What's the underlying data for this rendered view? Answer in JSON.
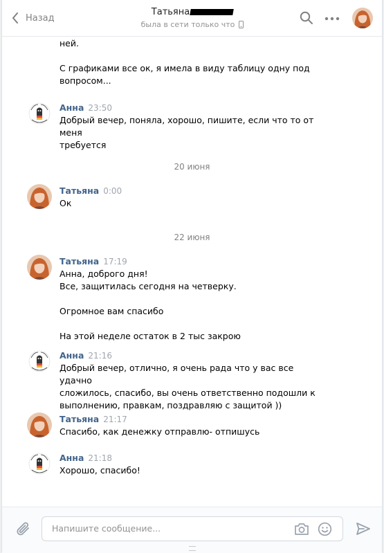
{
  "header": {
    "back_label": "Назад",
    "contact_name": "Татьяна",
    "status": "была в сети только что"
  },
  "chat": {
    "partial_text": "ней.\n\nС графиками все ок, я имела в виду таблицу одну под\nвопросом...",
    "messages": [
      {
        "author": "Анна",
        "time": "23:50",
        "text": "Добрый вечер, поняла, хорошо, пишите, если что то от меня\nтребуется"
      },
      {
        "author": "Татьяна",
        "time": "0:00",
        "text": "Ок"
      },
      {
        "author": "Татьяна",
        "time": "17:19",
        "text": "Анна, доброго дня!\nВсе, защитилась сегодня на четверку.\n\nОгромное вам спасибо\n\nНа этой неделе остаток в 2 тыс закрою"
      },
      {
        "author": "Анна",
        "time": "21:16",
        "text": "Добрый вечер, отлично, я очень рада что у вас все удачно\nсложилось, спасибо, вы очень ответственно подошли к\nвыполнению, правкам, поздравляю с защитой ))"
      },
      {
        "author": "Татьяна",
        "time": "21:17",
        "text": "Спасибо, как денежку отправлю- отпишусь"
      },
      {
        "author": "Анна",
        "time": "21:18",
        "text": "Хорошо, спасибо!"
      }
    ],
    "dates": [
      "20 июня",
      "22 июня"
    ]
  },
  "composer": {
    "placeholder": "Напишите сообщение..."
  },
  "icons": [
    "chevron-left-icon",
    "search-icon",
    "more-icon",
    "phone-icon",
    "attach-icon",
    "camera-icon",
    "smile-icon",
    "send-icon"
  ],
  "colors": {
    "accent": "#42648b",
    "time": "#a0a6ad",
    "background": "#ffffff"
  }
}
